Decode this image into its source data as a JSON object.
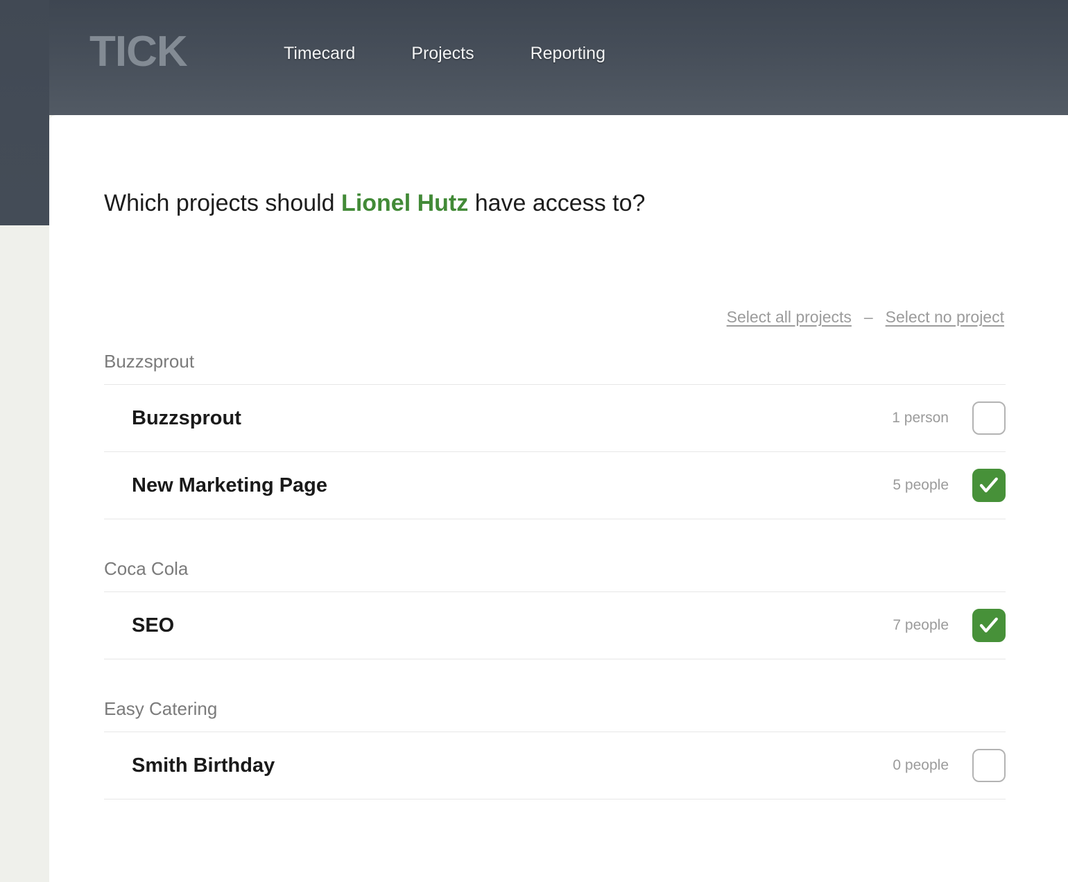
{
  "header": {
    "logo": "TICK",
    "nav": [
      {
        "label": "Timecard"
      },
      {
        "label": "Projects"
      },
      {
        "label": "Reporting"
      }
    ]
  },
  "main": {
    "title_prefix": "Which projects should ",
    "title_person": "Lionel Hutz",
    "title_suffix": " have access to?",
    "select_all_label": "Select all projects",
    "select_separator": "–",
    "select_none_label": "Select no project",
    "groups": [
      {
        "client": "Buzzsprout",
        "projects": [
          {
            "name": "Buzzsprout",
            "people": "1 person",
            "checked": false
          },
          {
            "name": "New Marketing Page",
            "people": "5 people",
            "checked": true
          }
        ]
      },
      {
        "client": "Coca Cola",
        "projects": [
          {
            "name": "SEO",
            "people": "7 people",
            "checked": true
          }
        ]
      },
      {
        "client": "Easy Catering",
        "projects": [
          {
            "name": "Smith Birthday",
            "people": "0 people",
            "checked": false
          }
        ]
      }
    ]
  },
  "colors": {
    "accent_green": "#479139",
    "header_dark": "#464e59",
    "page_background": "#eff0eb",
    "muted_text": "#9b9b9b"
  }
}
